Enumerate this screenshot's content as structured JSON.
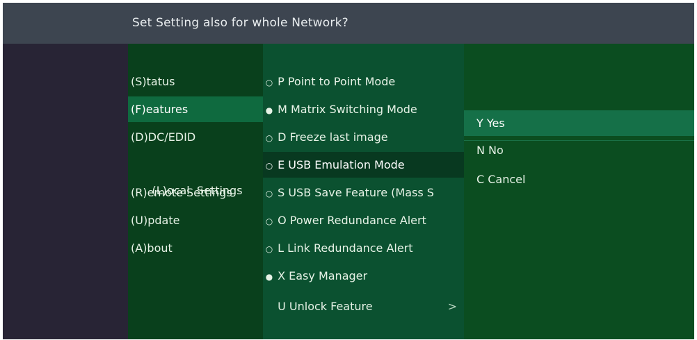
{
  "header": {
    "title": "Set Setting also for whole Network?"
  },
  "colors": {
    "header_bg": "#3d4550",
    "menu_bg": "#09401c",
    "submenu_bg": "#0b5130",
    "dialog_bg": "#0b4d20",
    "selected_bg": "#0f6a3f",
    "text": "#e6f2e6"
  },
  "main_menu": {
    "items": [
      {
        "label": "(S)tatus"
      },
      {
        "label": "(F)eatures"
      },
      {
        "label": "(D)DC/EDID"
      },
      {
        "label": "(L)ocal  Settings"
      },
      {
        "label": "(R)emote Settings"
      },
      {
        "label": "(U)pdate"
      },
      {
        "label": "(A)bout"
      }
    ],
    "selected": "(F)eatures"
  },
  "features_menu": {
    "items": [
      {
        "bullet": "○",
        "label": "P Point to Point Mode"
      },
      {
        "bullet": "●",
        "label": "M Matrix Switching Mode"
      },
      {
        "bullet": "○",
        "label": "D Freeze last image"
      },
      {
        "bullet": "○",
        "label": "E USB Emulation Mode"
      },
      {
        "bullet": "○",
        "label": "S USB Save Feature (Mass S"
      },
      {
        "bullet": "○",
        "label": "O Power Redundance Alert"
      },
      {
        "bullet": "○",
        "label": "L Link Redundance Alert"
      },
      {
        "bullet": "●",
        "label": "X Easy Manager"
      },
      {
        "bullet": "",
        "label": "U Unlock Feature",
        "submenu_indicator": ">"
      }
    ],
    "selected": "E USB Emulation Mode"
  },
  "confirm_dialog": {
    "options": [
      {
        "label": "Y Yes"
      },
      {
        "label": "N No"
      },
      {
        "label": "C Cancel"
      }
    ],
    "selected": "Y Yes"
  }
}
